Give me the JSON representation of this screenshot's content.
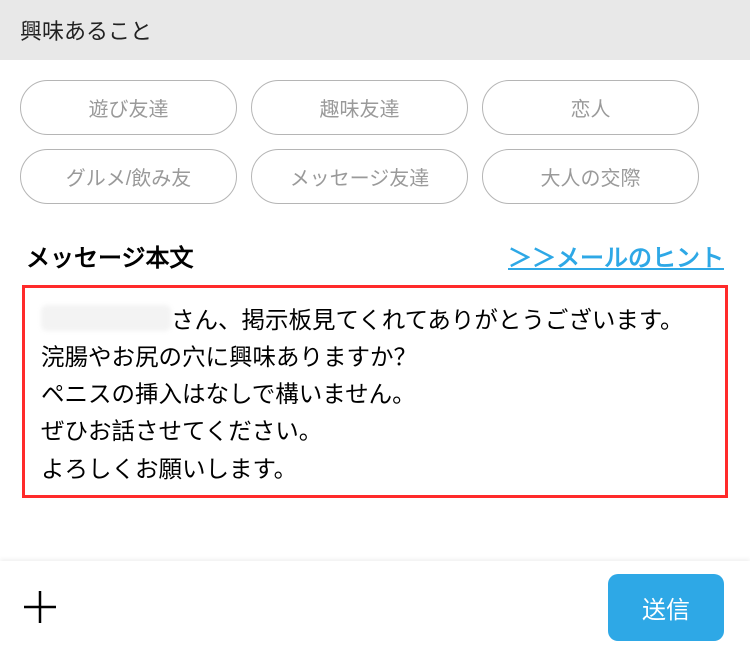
{
  "interests": {
    "header": "興味あること",
    "chips": [
      "遊び友達",
      "趣味友達",
      "恋人",
      "グルメ/飲み友",
      "メッセージ友達",
      "大人の交際"
    ]
  },
  "message": {
    "title": "メッセージ本文",
    "hint_link": "＞＞メールのヒント",
    "body_lines": [
      "さん、掲示板見てくれてありがとうございます。",
      "浣腸やお尻の穴に興味ありますか？",
      "ペニスの挿入はなしで構いません。",
      "ぜひお話させてください。",
      "よろしくお願いします。"
    ]
  },
  "footer": {
    "send_label": "送信"
  }
}
